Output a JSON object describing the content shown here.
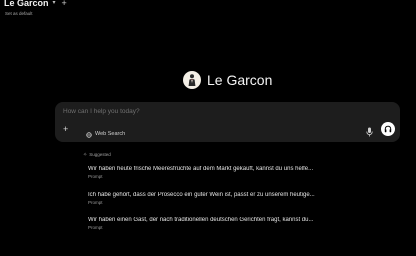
{
  "header": {
    "model_name": "Le Garcon",
    "set_default": "Set as default"
  },
  "brand": {
    "name": "Le Garcon"
  },
  "composer": {
    "placeholder": "How can I help you today?",
    "web_search_label": "Web Search"
  },
  "suggested": {
    "label": "Suggested",
    "items": [
      {
        "text": "Wir haben heute frische Meeresfrüchte auf dem Markt gekauft, kannst du uns helfe...",
        "kind": "Prompt"
      },
      {
        "text": "Ich habe gehört, dass der Prosecco ein guter Wein ist, passt er zu unserem heutige...",
        "kind": "Prompt"
      },
      {
        "text": "Wir haben einen Gast, der nach traditionellen deutschen Gerichten fragt, kannst du...",
        "kind": "Prompt"
      }
    ]
  },
  "colors": {
    "background": "#000000",
    "composer_bg": "#1d1d1d",
    "text_primary": "#ffffff",
    "text_muted": "#9a9a9a"
  }
}
